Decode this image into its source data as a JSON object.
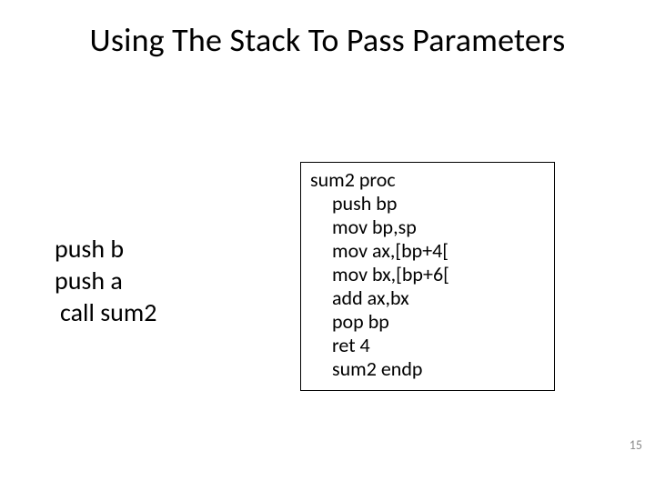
{
  "title": "Using The Stack To Pass Parameters",
  "caller": {
    "lines": [
      "push b",
      "push a",
      " call sum2"
    ]
  },
  "callee": {
    "lines": [
      {
        "text": "sum2 proc",
        "indent": false
      },
      {
        "text": "push bp",
        "indent": true
      },
      {
        "text": "mov bp,sp",
        "indent": true
      },
      {
        "text": "mov ax,[bp+4[",
        "indent": true
      },
      {
        "text": "mov bx,[bp+6[",
        "indent": true
      },
      {
        "text": "add ax,bx",
        "indent": true
      },
      {
        "text": "pop bp",
        "indent": true
      },
      {
        "text": "ret 4",
        "indent": true
      },
      {
        "text": "sum2 endp",
        "indent": true
      }
    ]
  },
  "page_number": "15"
}
